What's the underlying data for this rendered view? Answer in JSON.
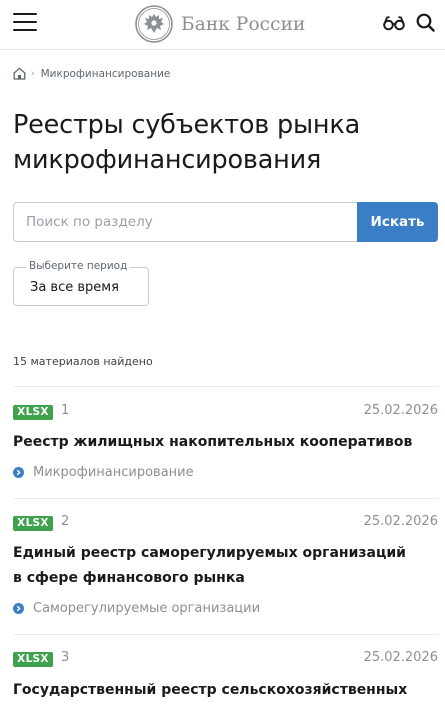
{
  "header": {
    "logo_text": "Банк России",
    "menu_icon": "hamburger-menu-icon",
    "accessibility_icon": "glasses-icon",
    "search_icon": "search-icon"
  },
  "breadcrumb": {
    "home_icon": "home-icon",
    "current": "Микрофинансирование"
  },
  "page_title": "Реестры субъектов рынка микрофинансирования",
  "search": {
    "placeholder": "Поиск по разделу",
    "button_label": "Искать"
  },
  "period": {
    "label": "Выберите период",
    "value": "За все время"
  },
  "results_count": "15 материалов найдено",
  "items": [
    {
      "format": "XLSX",
      "number": "1",
      "date": "25.02.2026",
      "title": "Реестр жилищных накопительных кооперативов",
      "category": "Микрофинансирование"
    },
    {
      "format": "XLSX",
      "number": "2",
      "date": "25.02.2026",
      "title_line1": "Единый реестр саморегулируемых организаций",
      "title_line2": "в сфере финансового рынка",
      "category": "Саморегулируемые организации"
    },
    {
      "format": "XLSX",
      "number": "3",
      "date": "25.02.2026",
      "title": "Государственный реестр сельскохозяйственных"
    }
  ],
  "colors": {
    "accent_blue": "#3a7ec6",
    "xlsx_green": "#3fa34d",
    "muted_text": "#8b8f96"
  }
}
